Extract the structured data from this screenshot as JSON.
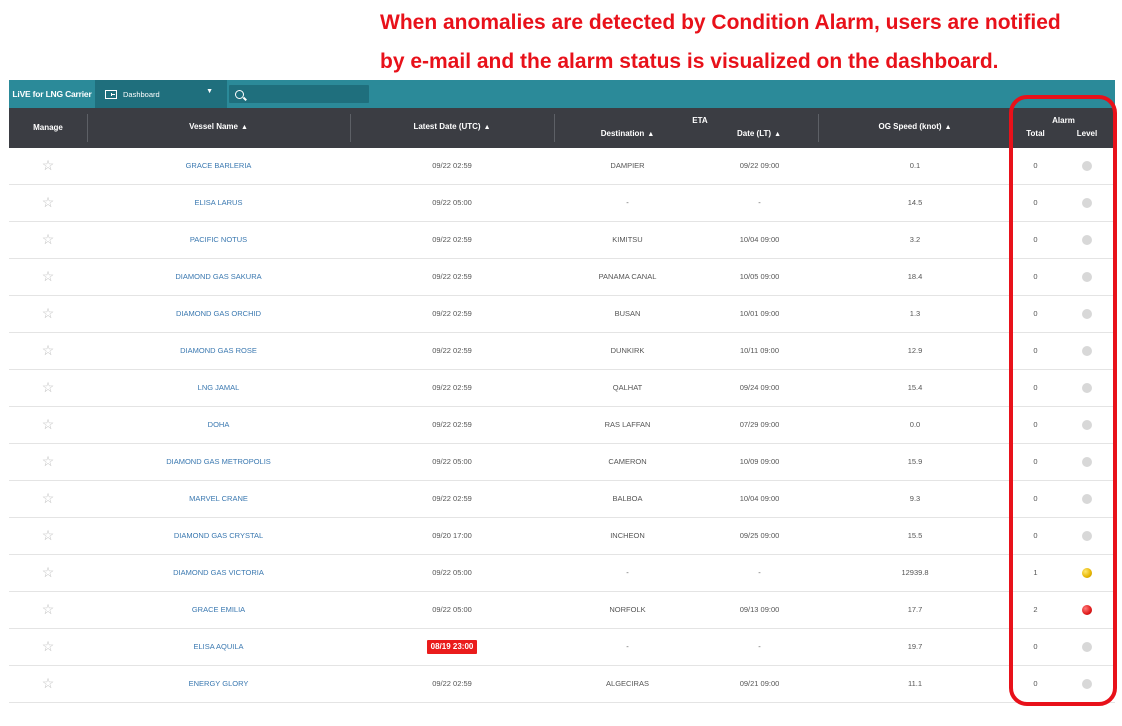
{
  "caption": {
    "line1": "When anomalies are detected by Condition Alarm, users are notified",
    "line2": "by e-mail and the alarm status is visualized on the dashboard."
  },
  "topbar": {
    "brand": "LiVE for LNG Carrier",
    "dashboard_label": "Dashboard",
    "search_placeholder": ""
  },
  "header": {
    "manage": "Manage",
    "vessel_name": "Vessel Name",
    "latest_date": "Latest Date (UTC)",
    "eta": "ETA",
    "destination": "Destination",
    "date_lt": "Date (LT)",
    "og_speed": "OG Speed (knot)",
    "alarm": "Alarm",
    "total": "Total",
    "level": "Level"
  },
  "colors": {
    "accent": "#2b8a99",
    "header_bg": "#3b3d43",
    "highlight": "#e8111a",
    "link": "#3a78b0"
  },
  "rows": [
    {
      "name": "GRACE BARLERIA",
      "date": "09/22 02:59",
      "dest": "DAMPIER",
      "eta": "09/22 09:00",
      "speed": "0.1",
      "total": "0",
      "level": "none",
      "late": false
    },
    {
      "name": "ELISA LARUS",
      "date": "09/22 05:00",
      "dest": "-",
      "eta": "-",
      "speed": "14.5",
      "total": "0",
      "level": "none",
      "late": false
    },
    {
      "name": "PACIFIC NOTUS",
      "date": "09/22 02:59",
      "dest": "KIMITSU",
      "eta": "10/04 09:00",
      "speed": "3.2",
      "total": "0",
      "level": "none",
      "late": false
    },
    {
      "name": "DIAMOND GAS SAKURA",
      "date": "09/22 02:59",
      "dest": "PANAMA CANAL",
      "eta": "10/05 09:00",
      "speed": "18.4",
      "total": "0",
      "level": "none",
      "late": false
    },
    {
      "name": "DIAMOND GAS ORCHID",
      "date": "09/22 02:59",
      "dest": "BUSAN",
      "eta": "10/01 09:00",
      "speed": "1.3",
      "total": "0",
      "level": "none",
      "late": false
    },
    {
      "name": "DIAMOND GAS ROSE",
      "date": "09/22 02:59",
      "dest": "DUNKIRK",
      "eta": "10/11 09:00",
      "speed": "12.9",
      "total": "0",
      "level": "none",
      "late": false
    },
    {
      "name": "LNG JAMAL",
      "date": "09/22 02:59",
      "dest": "QALHAT",
      "eta": "09/24 09:00",
      "speed": "15.4",
      "total": "0",
      "level": "none",
      "late": false
    },
    {
      "name": "DOHA",
      "date": "09/22 02:59",
      "dest": "RAS LAFFAN",
      "eta": "07/29 09:00",
      "speed": "0.0",
      "total": "0",
      "level": "none",
      "late": false
    },
    {
      "name": "DIAMOND GAS METROPOLIS",
      "date": "09/22 05:00",
      "dest": "CAMERON",
      "eta": "10/09 09:00",
      "speed": "15.9",
      "total": "0",
      "level": "none",
      "late": false
    },
    {
      "name": "MARVEL CRANE",
      "date": "09/22 02:59",
      "dest": "BALBOA",
      "eta": "10/04 09:00",
      "speed": "9.3",
      "total": "0",
      "level": "none",
      "late": false
    },
    {
      "name": "DIAMOND GAS CRYSTAL",
      "date": "09/20 17:00",
      "dest": "INCHEON",
      "eta": "09/25 09:00",
      "speed": "15.5",
      "total": "0",
      "level": "none",
      "late": false
    },
    {
      "name": "DIAMOND GAS VICTORIA",
      "date": "09/22 05:00",
      "dest": "-",
      "eta": "-",
      "speed": "12939.8",
      "total": "1",
      "level": "yellow",
      "late": false
    },
    {
      "name": "GRACE EMILIA",
      "date": "09/22 05:00",
      "dest": "NORFOLK",
      "eta": "09/13 09:00",
      "speed": "17.7",
      "total": "2",
      "level": "red",
      "late": false
    },
    {
      "name": "ELISA AQUILA",
      "date": "08/19 23:00",
      "dest": "-",
      "eta": "-",
      "speed": "19.7",
      "total": "0",
      "level": "none",
      "late": true
    },
    {
      "name": "ENERGY GLORY",
      "date": "09/22 02:59",
      "dest": "ALGECIRAS",
      "eta": "09/21 09:00",
      "speed": "11.1",
      "total": "0",
      "level": "none",
      "late": false
    }
  ]
}
